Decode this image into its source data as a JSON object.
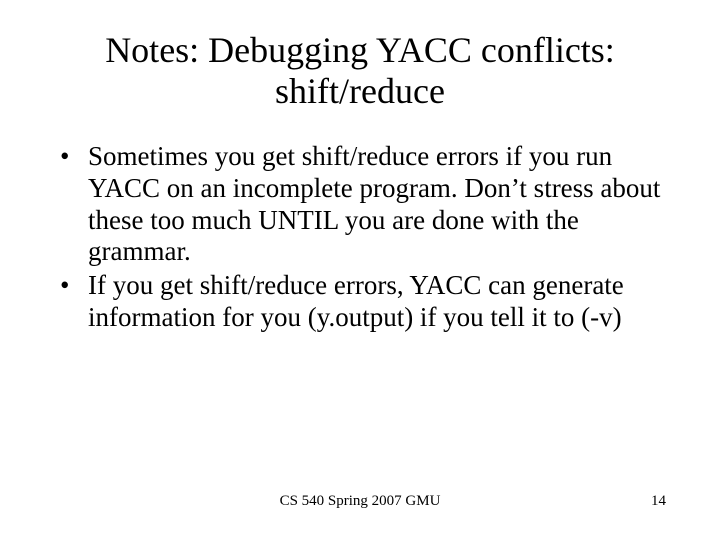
{
  "title_line1": "Notes: Debugging YACC conflicts:",
  "title_line2": "shift/reduce",
  "bullets": [
    "Sometimes you get shift/reduce errors if you run YACC on an incomplete program. Don’t stress about these too much UNTIL you are done with the grammar.",
    "If you get shift/reduce errors, YACC can generate information for you (y.output) if you tell it to (-v)"
  ],
  "footer_center": "CS 540 Spring 2007 GMU",
  "footer_right": "14"
}
